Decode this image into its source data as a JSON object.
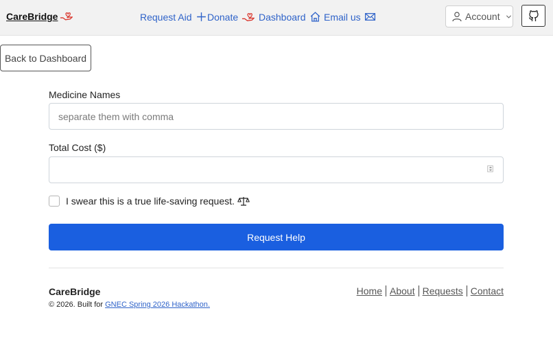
{
  "navbar": {
    "brand": "CareBridge",
    "links": [
      {
        "label": "Request Aid",
        "icon": "plus-icon"
      },
      {
        "label": "Donate",
        "icon": "hand-heart-icon"
      },
      {
        "label": "Dashboard",
        "icon": "house-icon"
      },
      {
        "label": "Email us",
        "icon": "envelope-icon"
      }
    ],
    "account_label": "Account",
    "github_icon": "github-icon"
  },
  "back_button": "Back to Dashboard",
  "form": {
    "medicine_label": "Medicine Names",
    "medicine_placeholder": "separate them with comma",
    "medicine_value": "",
    "cost_label": "Total Cost ($)",
    "cost_value": "",
    "checkbox_label": "I swear this is a true life-saving request.",
    "checkbox_checked": false,
    "submit_label": "Request Help"
  },
  "footer": {
    "brand": "CareBridge",
    "copyright_prefix": "© 2026. Built for",
    "hackathon_link": "GNEC Spring 2026 Hackathon.",
    "links": [
      "Home",
      "About",
      "Requests",
      "Contact"
    ]
  },
  "colors": {
    "primary": "#1a5fe0",
    "link": "#2f63c9",
    "brand_icon": "#d9342b"
  }
}
